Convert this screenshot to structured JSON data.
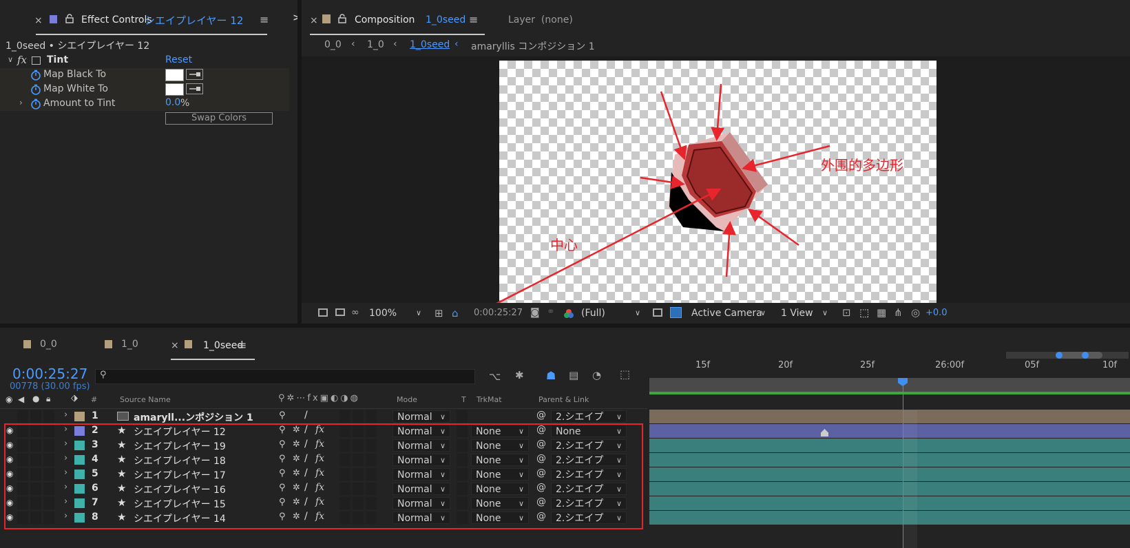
{
  "effect_controls": {
    "tab_label": "Effect Controls",
    "tab_layer": "シエイプレイヤー 12",
    "subtitle": "1_0seed • シエイプレイヤー 12",
    "effect_name": "Tint",
    "reset_label": "Reset",
    "properties": [
      {
        "label": "Map Black To"
      },
      {
        "label": "Map White To"
      },
      {
        "label": "Amount to Tint",
        "value": "0.0",
        "unit": "%"
      }
    ],
    "swap_label": "Swap Colors",
    "expand_label": ">>"
  },
  "composition": {
    "tab_label": "Composition",
    "tab_comp": "1_0seed",
    "layer_label": "Layer  (none)",
    "breadcrumb": [
      "0_0",
      "1_0",
      "1_0seed"
    ],
    "breadcrumb_tail": "amaryllis コンポジション 1",
    "annotation_outer": "外围的多边形",
    "annotation_center": "中心",
    "toolbar": {
      "zoom": "100%",
      "timecode": "0:00:25:27",
      "resolution": "(Full)",
      "camera": "Active Camera",
      "views": "1 View",
      "exposure": "+0.0"
    }
  },
  "timeline": {
    "tabs": [
      "0_0",
      "1_0",
      "1_0seed"
    ],
    "tab_colors": [
      "#b39f7e",
      "#b39f7e",
      "#b39f7e"
    ],
    "timecode": "0:00:25:27",
    "frame_info": "00778 (30.00 fps)",
    "headers": {
      "num": "#",
      "source_name": "Source Name",
      "mode": "Mode",
      "t": "T",
      "trkmat": "TrkMat",
      "parent": "Parent & Link"
    },
    "ruler": [
      "15f",
      "20f",
      "25f",
      "26:00f",
      "05f",
      "10f"
    ],
    "layers": [
      {
        "num": "1",
        "name": "amaryll...ンポジション 1",
        "color": "#b39f7e",
        "mode": "Normal",
        "trkmat": "",
        "parent": "2.シエイプ",
        "bar": "#7a6b5a"
      },
      {
        "num": "2",
        "name": "シエイプレイヤー 12",
        "color": "#7a7ddc",
        "mode": "Normal",
        "trkmat": "None",
        "parent": "None",
        "bar": "#5b61a3"
      },
      {
        "num": "3",
        "name": "シエイプレイヤー 19",
        "color": "#3fb0aa",
        "mode": "Normal",
        "trkmat": "None",
        "parent": "2.シエイプ",
        "bar": "#3a7f7b"
      },
      {
        "num": "4",
        "name": "シエイプレイヤー 18",
        "color": "#3fb0aa",
        "mode": "Normal",
        "trkmat": "None",
        "parent": "2.シエイプ",
        "bar": "#3a7f7b"
      },
      {
        "num": "5",
        "name": "シエイプレイヤー 17",
        "color": "#3fb0aa",
        "mode": "Normal",
        "trkmat": "None",
        "parent": "2.シエイプ",
        "bar": "#3a7f7b"
      },
      {
        "num": "6",
        "name": "シエイプレイヤー 16",
        "color": "#3fb0aa",
        "mode": "Normal",
        "trkmat": "None",
        "parent": "2.シエイプ",
        "bar": "#3a7f7b"
      },
      {
        "num": "7",
        "name": "シエイプレイヤー 15",
        "color": "#3fb0aa",
        "mode": "Normal",
        "trkmat": "None",
        "parent": "2.シエイプ",
        "bar": "#3a7f7b"
      },
      {
        "num": "8",
        "name": "シエイプレイヤー 14",
        "color": "#3fb0aa",
        "mode": "Normal",
        "trkmat": "None",
        "parent": "2.シエイプ",
        "bar": "#3a7f7b"
      }
    ]
  },
  "colors": {
    "accent": "#4a9bff",
    "annotation": "#e8242c",
    "shape_fill": "#9b2a2a"
  }
}
